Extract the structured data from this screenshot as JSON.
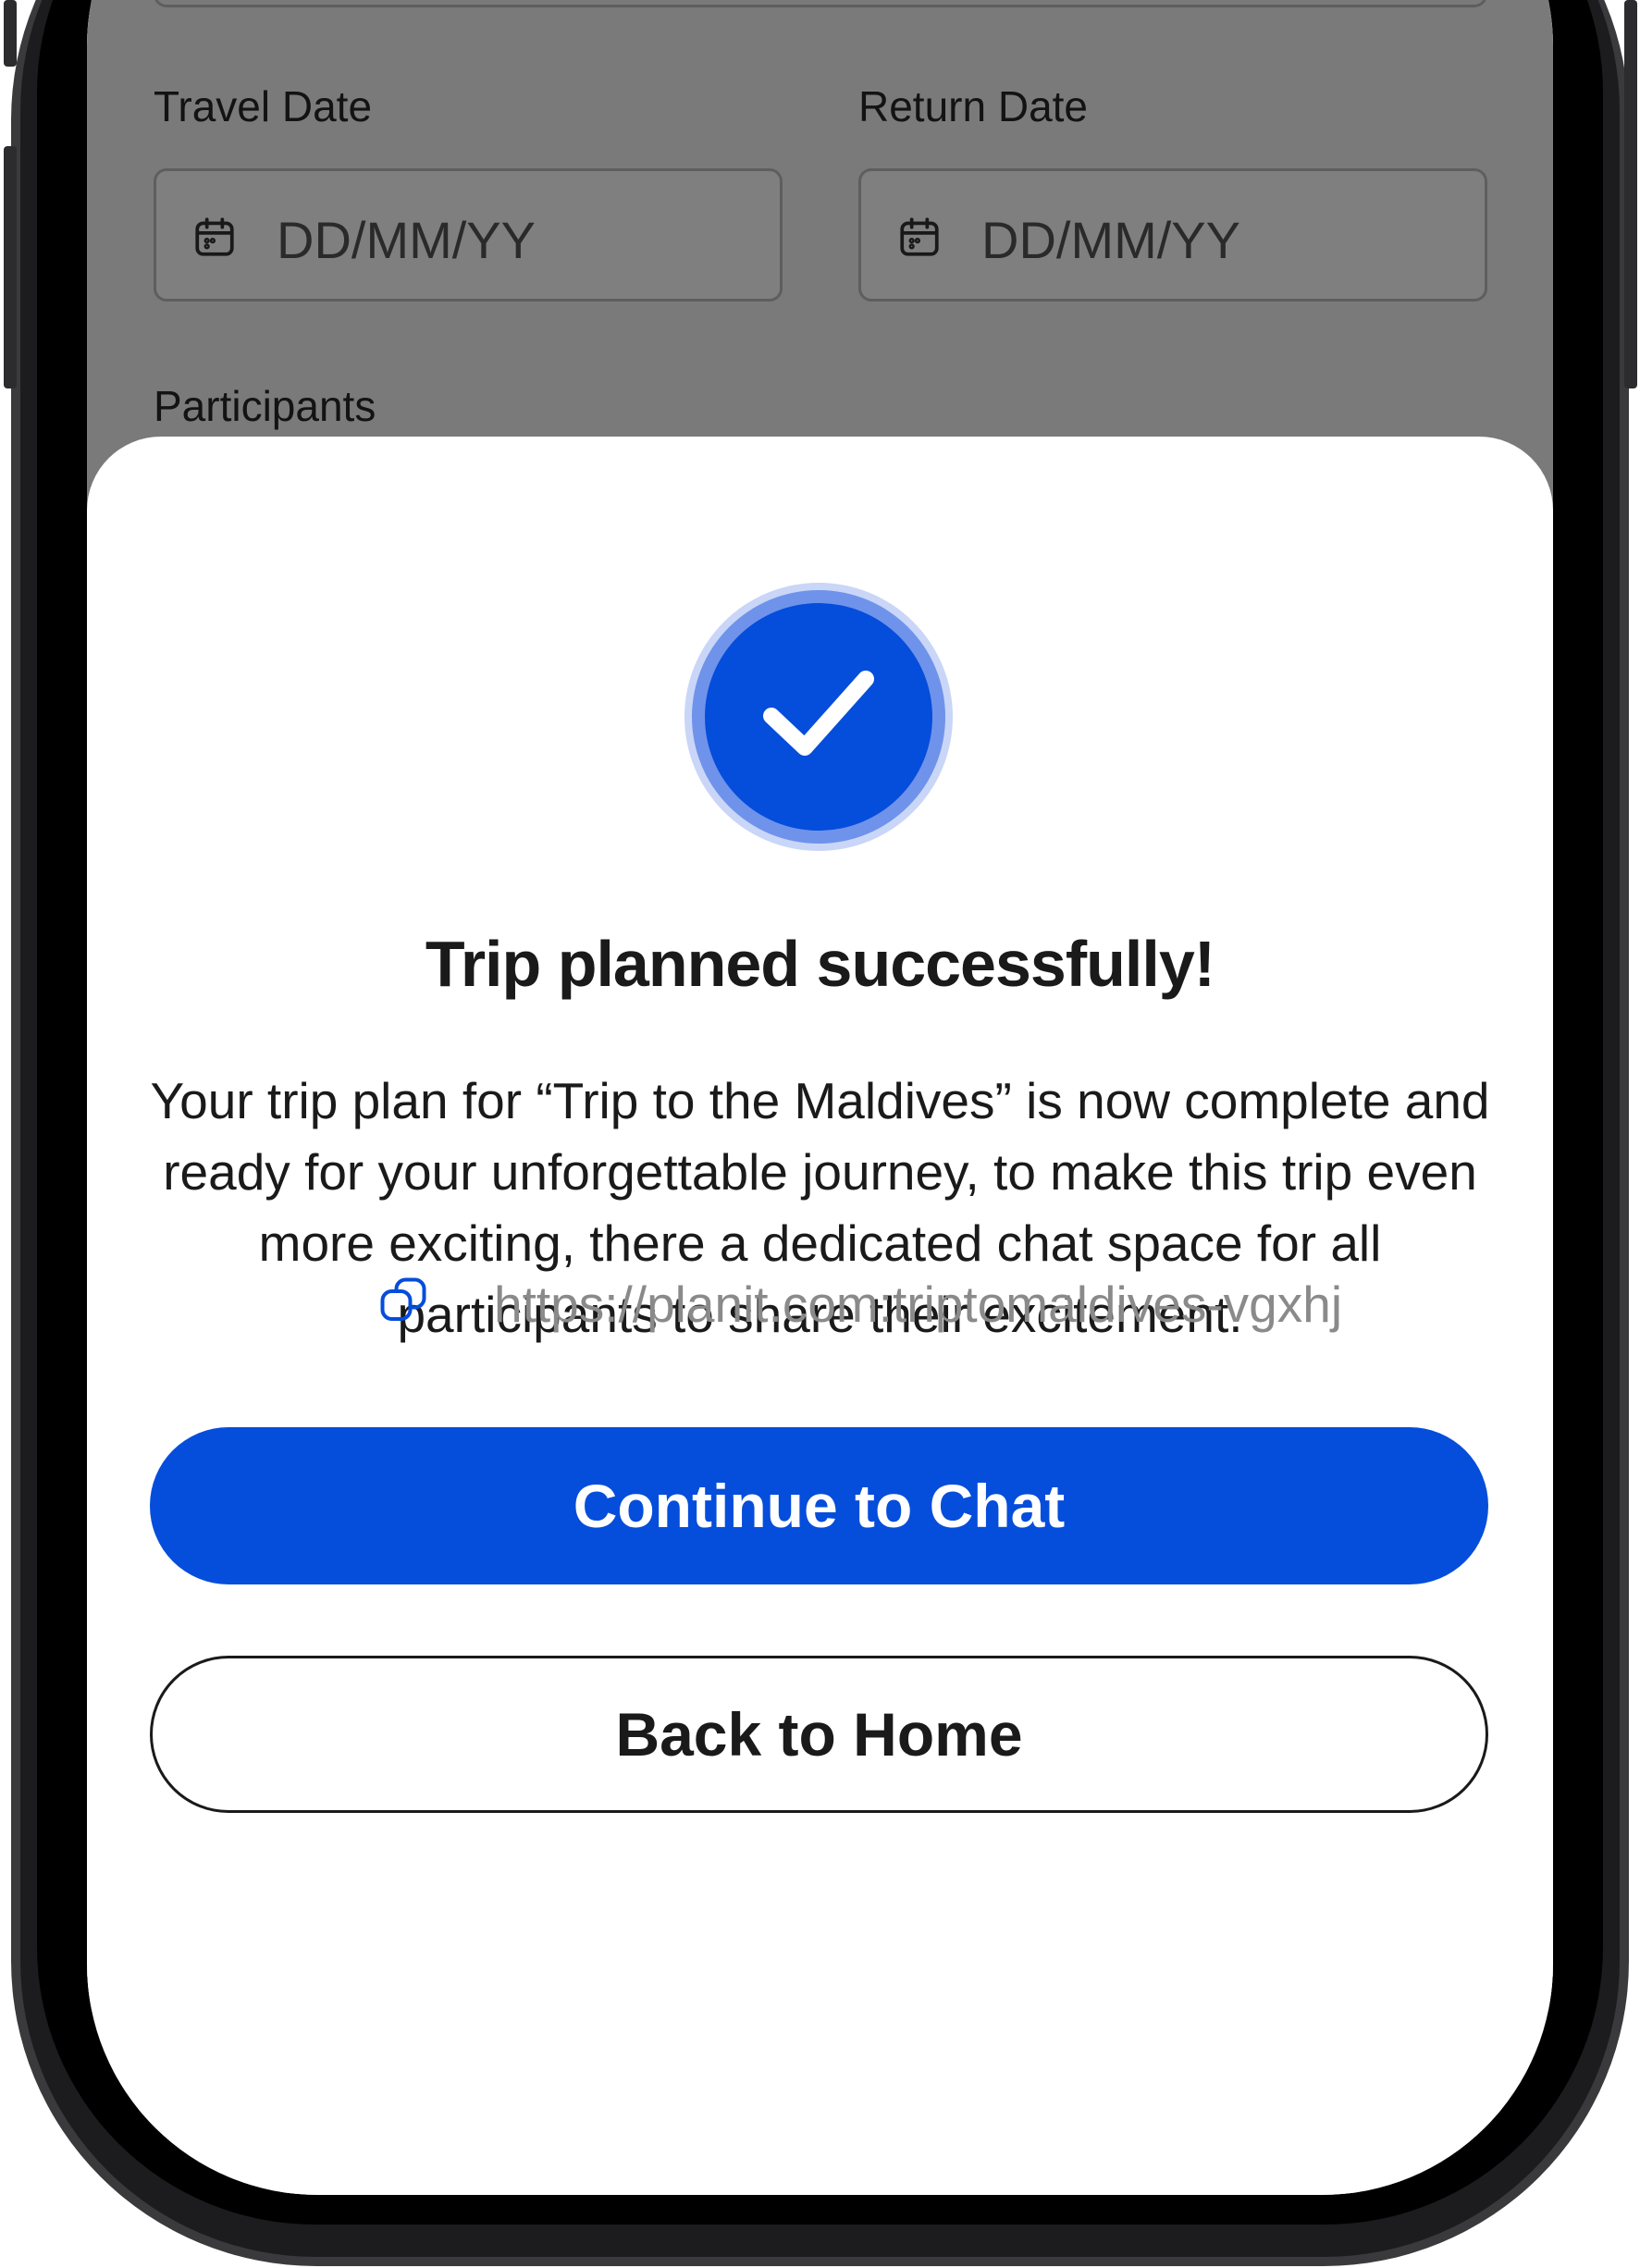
{
  "form": {
    "travel_date_label": "Travel Date",
    "return_date_label": "Return Date",
    "travel_date_placeholder": "DD/MM/YY",
    "return_date_placeholder": "DD/MM/YY",
    "participants_label": "Participants"
  },
  "dialog": {
    "title": "Trip planned successfully!",
    "description": "Your trip plan for “Trip to the Maldives” is now complete and ready for your unforgettable journey, to make this trip even more exciting, there a dedicated chat space for all participants to share their excitement.",
    "link": "https://planit.com:triptomaldives-vgxhj",
    "primary_button": "Continue to Chat",
    "secondary_button": "Back to Home"
  },
  "colors": {
    "accent": "#054DDB",
    "overlay": "rgba(0,0,0,0.5)"
  },
  "icons": [
    "calendar-icon",
    "check-icon",
    "copy-icon"
  ]
}
